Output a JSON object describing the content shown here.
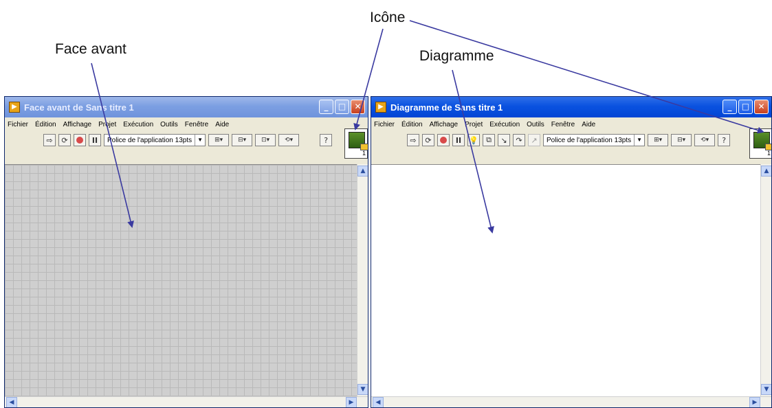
{
  "annotations": {
    "icone": "Icône",
    "face_avant": "Face avant",
    "diagramme": "Diagramme"
  },
  "front_panel": {
    "title": "Face avant de Sans titre 1",
    "menu": [
      "Fichier",
      "Édition",
      "Affichage",
      "Projet",
      "Exécution",
      "Outils",
      "Fenêtre",
      "Aide"
    ],
    "font": "Police de l'application 13pts",
    "icon_number": "1"
  },
  "block_diagram": {
    "title": "Diagramme de Sans titre 1",
    "menu": [
      "Fichier",
      "Édition",
      "Affichage",
      "Projet",
      "Exécution",
      "Outils",
      "Fenêtre",
      "Aide"
    ],
    "font": "Police de l'application 13pts",
    "icon_number": "1"
  },
  "icons": {
    "run": "run-arrow-icon",
    "run_continuous": "run-continuous-icon",
    "abort": "abort-icon",
    "pause": "pause-icon",
    "highlight": "highlight-execution-icon",
    "retain_wire": "retain-wire-values-icon",
    "step_into": "step-into-icon",
    "step_over": "step-over-icon",
    "step_out": "step-out-icon",
    "align": "align-objects-icon",
    "distribute": "distribute-objects-icon",
    "resize": "resize-objects-icon",
    "reorder": "reorder-icon",
    "help": "context-help-icon"
  },
  "colors": {
    "title_active": "#0a52e0",
    "title_inactive": "#7c9fe2",
    "annotation_arrow": "#3a3aa0",
    "front_panel_bg": "#cfcfcf",
    "diagram_bg": "#ffffff"
  }
}
